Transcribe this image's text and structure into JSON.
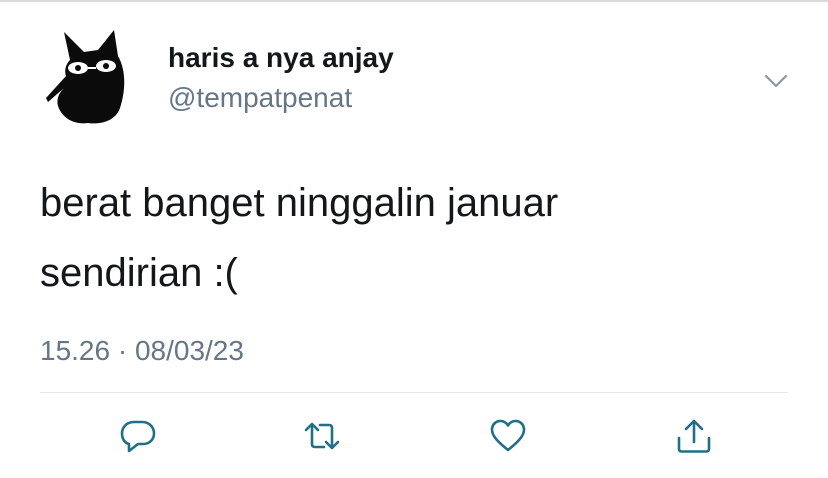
{
  "tweet": {
    "author": {
      "display_name": "haris a nya anjay",
      "handle": "@tempatpenat",
      "avatar_icon": "black-cat-avatar"
    },
    "text_lines": [
      "berat banget ninggalin januar",
      "sendirian :("
    ],
    "timestamp": "15.26 · 08/03/23",
    "menu_icon": "chevron-down-icon"
  },
  "actions": [
    {
      "name": "reply",
      "icon": "reply-icon"
    },
    {
      "name": "retweet",
      "icon": "retweet-icon"
    },
    {
      "name": "like",
      "icon": "heart-icon"
    },
    {
      "name": "share",
      "icon": "share-icon"
    }
  ],
  "colors": {
    "text_primary": "#14171a",
    "text_secondary": "#657786",
    "icon": "#1f6f86",
    "divider": "#e1e8ed"
  }
}
